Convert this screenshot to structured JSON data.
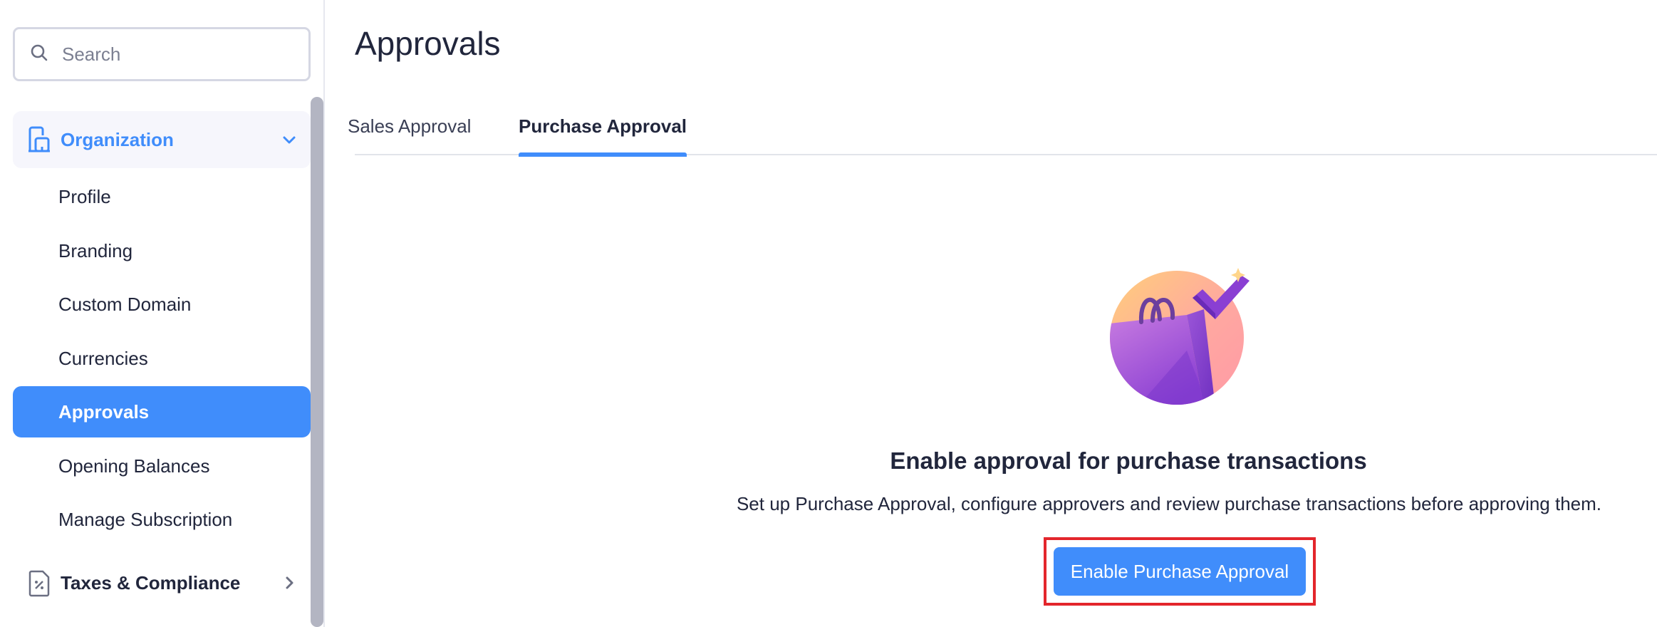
{
  "sidebar": {
    "search": {
      "placeholder": "Search",
      "icon": "search-icon"
    },
    "groups": [
      {
        "label": "Organization",
        "icon": "building-icon",
        "expanded": true
      },
      {
        "label": "Taxes & Compliance",
        "icon": "tax-document-icon",
        "expanded": false
      }
    ],
    "items": [
      {
        "label": "Profile"
      },
      {
        "label": "Branding"
      },
      {
        "label": "Custom Domain"
      },
      {
        "label": "Currencies"
      },
      {
        "label": "Approvals",
        "active": true
      },
      {
        "label": "Opening Balances"
      },
      {
        "label": "Manage Subscription"
      }
    ]
  },
  "main": {
    "title": "Approvals",
    "tabs": [
      {
        "label": "Sales Approval",
        "active": false
      },
      {
        "label": "Purchase Approval",
        "active": true
      }
    ],
    "empty_state": {
      "illustration": "shopping-bag-check-illustration",
      "heading": "Enable approval for purchase transactions",
      "description": "Set up Purchase Approval, configure approvers and review purchase transactions before approving them.",
      "button_label": "Enable Purchase Approval"
    }
  },
  "colors": {
    "accent": "#408dfb",
    "highlight_border": "#e3262c",
    "text": "#21263c"
  }
}
